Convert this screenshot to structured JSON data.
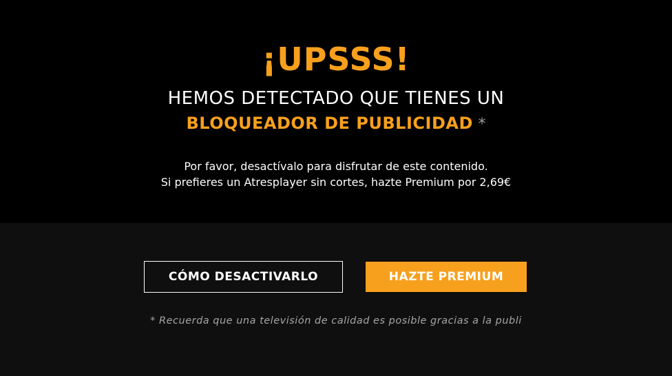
{
  "colors": {
    "accent": "#f7a01d",
    "top_background": "#000000",
    "bottom_background": "#0f0f0f",
    "text": "#ffffff",
    "muted": "#a6a6a6"
  },
  "message": {
    "title": "¡UPSSS!",
    "line1": "HEMOS DETECTADO QUE TIENES UN",
    "highlight": "BLOQUEADOR DE PUBLICIDAD",
    "asterisk": "*",
    "description_line1": "Por favor, desactívalo para disfrutar de este contenido.",
    "description_line2": "Si prefieres un Atresplayer sin cortes, hazte Premium por 2,69€"
  },
  "buttons": {
    "how_to_disable": "CÓMO DESACTIVARLO",
    "go_premium": "HAZTE PREMIUM"
  },
  "footnote": "* Recuerda que una televisión de calidad es posible gracias a la publi"
}
